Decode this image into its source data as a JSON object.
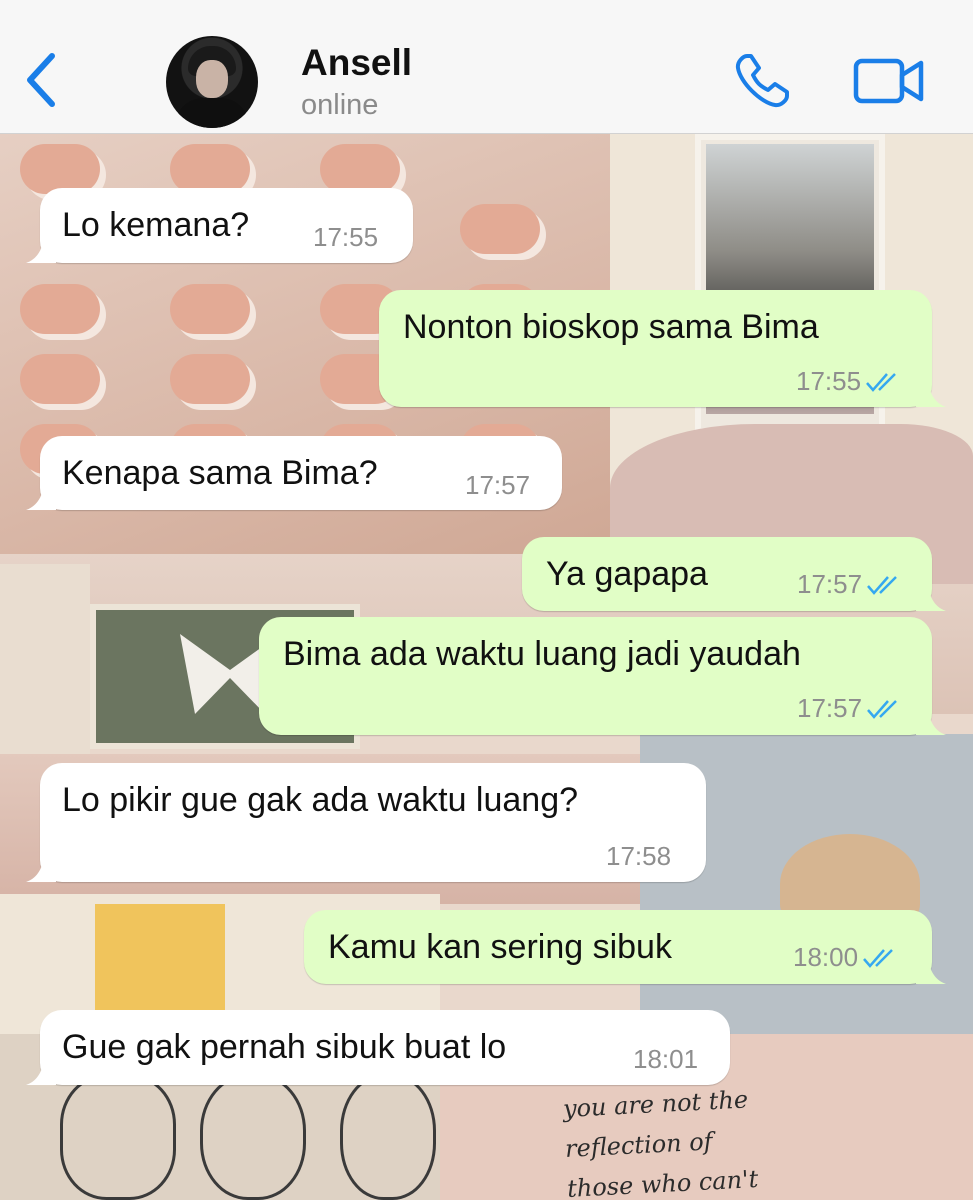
{
  "contact": {
    "name": "Ansell",
    "status": "online"
  },
  "icons": {
    "back": "chevron-left-icon",
    "call": "phone-icon",
    "video": "video-camera-icon",
    "ticks": "double-check-icon"
  },
  "colors": {
    "accent": "#1a7ee8",
    "incoming_bubble": "#ffffff",
    "outgoing_bubble": "#e1fec6",
    "read_ticks": "#35a8f0"
  },
  "wallpaper": {
    "handwriting": [
      "you   are  not   the",
      "reflection   of",
      "those   who  can't"
    ]
  },
  "messages": [
    {
      "direction": "in",
      "text": "Lo kemana?",
      "time": "17:55"
    },
    {
      "direction": "out",
      "text": "Nonton bioskop sama Bima",
      "time": "17:55",
      "read": true
    },
    {
      "direction": "in",
      "text": "Kenapa sama Bima?",
      "time": "17:57"
    },
    {
      "direction": "out",
      "text": "Ya gapapa",
      "time": "17:57",
      "read": true
    },
    {
      "direction": "out",
      "text": "Bima ada waktu luang jadi yaudah",
      "time": "17:57",
      "read": true
    },
    {
      "direction": "in",
      "text": "Lo pikir gue gak ada waktu luang?",
      "time": "17:58"
    },
    {
      "direction": "out",
      "text": "Kamu kan sering sibuk",
      "time": "18:00",
      "read": true
    },
    {
      "direction": "in",
      "text": "Gue gak pernah sibuk buat lo",
      "time": "18:01"
    }
  ]
}
